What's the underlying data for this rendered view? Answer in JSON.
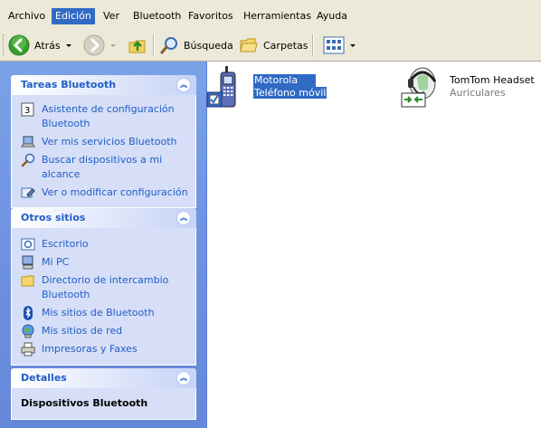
{
  "menu": {
    "items": [
      "Archivo",
      "Edición",
      "Ver",
      "Bluetooth",
      "Favoritos",
      "Herramientas",
      "Ayuda"
    ],
    "active": "Edición"
  },
  "toolbar": {
    "back_label": "Atrás",
    "search_label": "Búsqueda",
    "folders_label": "Carpetas"
  },
  "taskpane": {
    "bluetooth_tasks": {
      "title": "Tareas Bluetooth",
      "items": [
        {
          "label": "Asistente de configuración Bluetooth",
          "icon": "wizard-icon"
        },
        {
          "label": "Ver mis servicios Bluetooth",
          "icon": "laptop-icon"
        },
        {
          "label": "Buscar dispositivos a mi alcance",
          "icon": "magnifier-icon"
        },
        {
          "label": "Ver o modificar configuración",
          "icon": "settings-icon"
        }
      ]
    },
    "other_places": {
      "title": "Otros sitios",
      "items": [
        {
          "label": "Escritorio",
          "icon": "desktop-icon"
        },
        {
          "label": "Mi PC",
          "icon": "computer-icon"
        },
        {
          "label": "Directorio de intercambio Bluetooth",
          "icon": "folder-icon"
        },
        {
          "label": "Mis sitios de Bluetooth",
          "icon": "bluetooth-icon"
        },
        {
          "label": "Mis sitios de red",
          "icon": "network-icon"
        },
        {
          "label": "Impresoras y Faxes",
          "icon": "printer-icon"
        }
      ]
    },
    "details": {
      "title": "Detalles",
      "value": "Dispositivos Bluetooth"
    }
  },
  "devices": [
    {
      "name": "Motorola",
      "type": "Teléfono móvil",
      "icon": "mobile-phone-icon",
      "selected": true
    },
    {
      "name": "TomTom Headset",
      "type": "Auriculares",
      "icon": "headset-icon",
      "selected": false
    }
  ],
  "colors": {
    "accent": "#316ac5",
    "taskpane_bg": "#7ba2e7",
    "panel_body": "#d6dff7",
    "link": "#215dc6"
  }
}
